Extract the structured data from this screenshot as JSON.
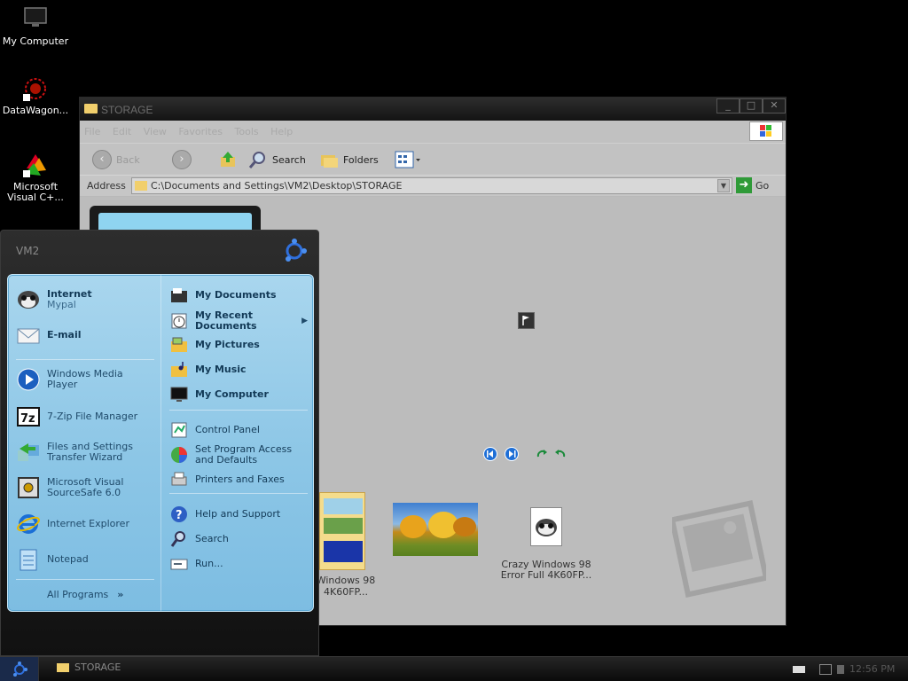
{
  "desktop": {
    "icons": [
      {
        "label": "My Computer"
      },
      {
        "label": "DataWagon..."
      },
      {
        "label": "Microsoft Visual C+..."
      }
    ]
  },
  "window": {
    "title": "STORAGE",
    "menus": [
      "File",
      "Edit",
      "View",
      "Favorites",
      "Tools",
      "Help"
    ],
    "toolbar": {
      "back": "Back",
      "search": "Search",
      "folders": "Folders"
    },
    "address": {
      "label": "Address",
      "value": "C:\\Documents and Settings\\VM2\\Desktop\\STORAGE",
      "go": "Go"
    },
    "files": [
      {
        "label": "Windows 98 4K60FP..."
      },
      {
        "label": ""
      },
      {
        "label": "Crazy Windows 98 Error Full 4K60FP..."
      }
    ]
  },
  "start_menu": {
    "user": "VM2",
    "pinned": [
      {
        "title": "Internet",
        "subtitle": "Mypal"
      },
      {
        "title": "E-mail",
        "subtitle": ""
      }
    ],
    "recent": [
      "Windows Media Player",
      "7-Zip File Manager",
      "Files and Settings Transfer Wizard",
      "Microsoft Visual SourceSafe 6.0",
      "Internet Explorer",
      "Notepad"
    ],
    "all_programs": "All Programs",
    "right_top": [
      "My Documents",
      "My Recent Documents",
      "My Pictures",
      "My Music",
      "My Computer"
    ],
    "right_mid": [
      "Control Panel",
      "Set Program Access and Defaults",
      "Printers and Faxes"
    ],
    "right_bottom": [
      "Help and Support",
      "Search",
      "Run..."
    ]
  },
  "taskbar": {
    "task_label": "STORAGE",
    "clock": "12:56 PM"
  }
}
